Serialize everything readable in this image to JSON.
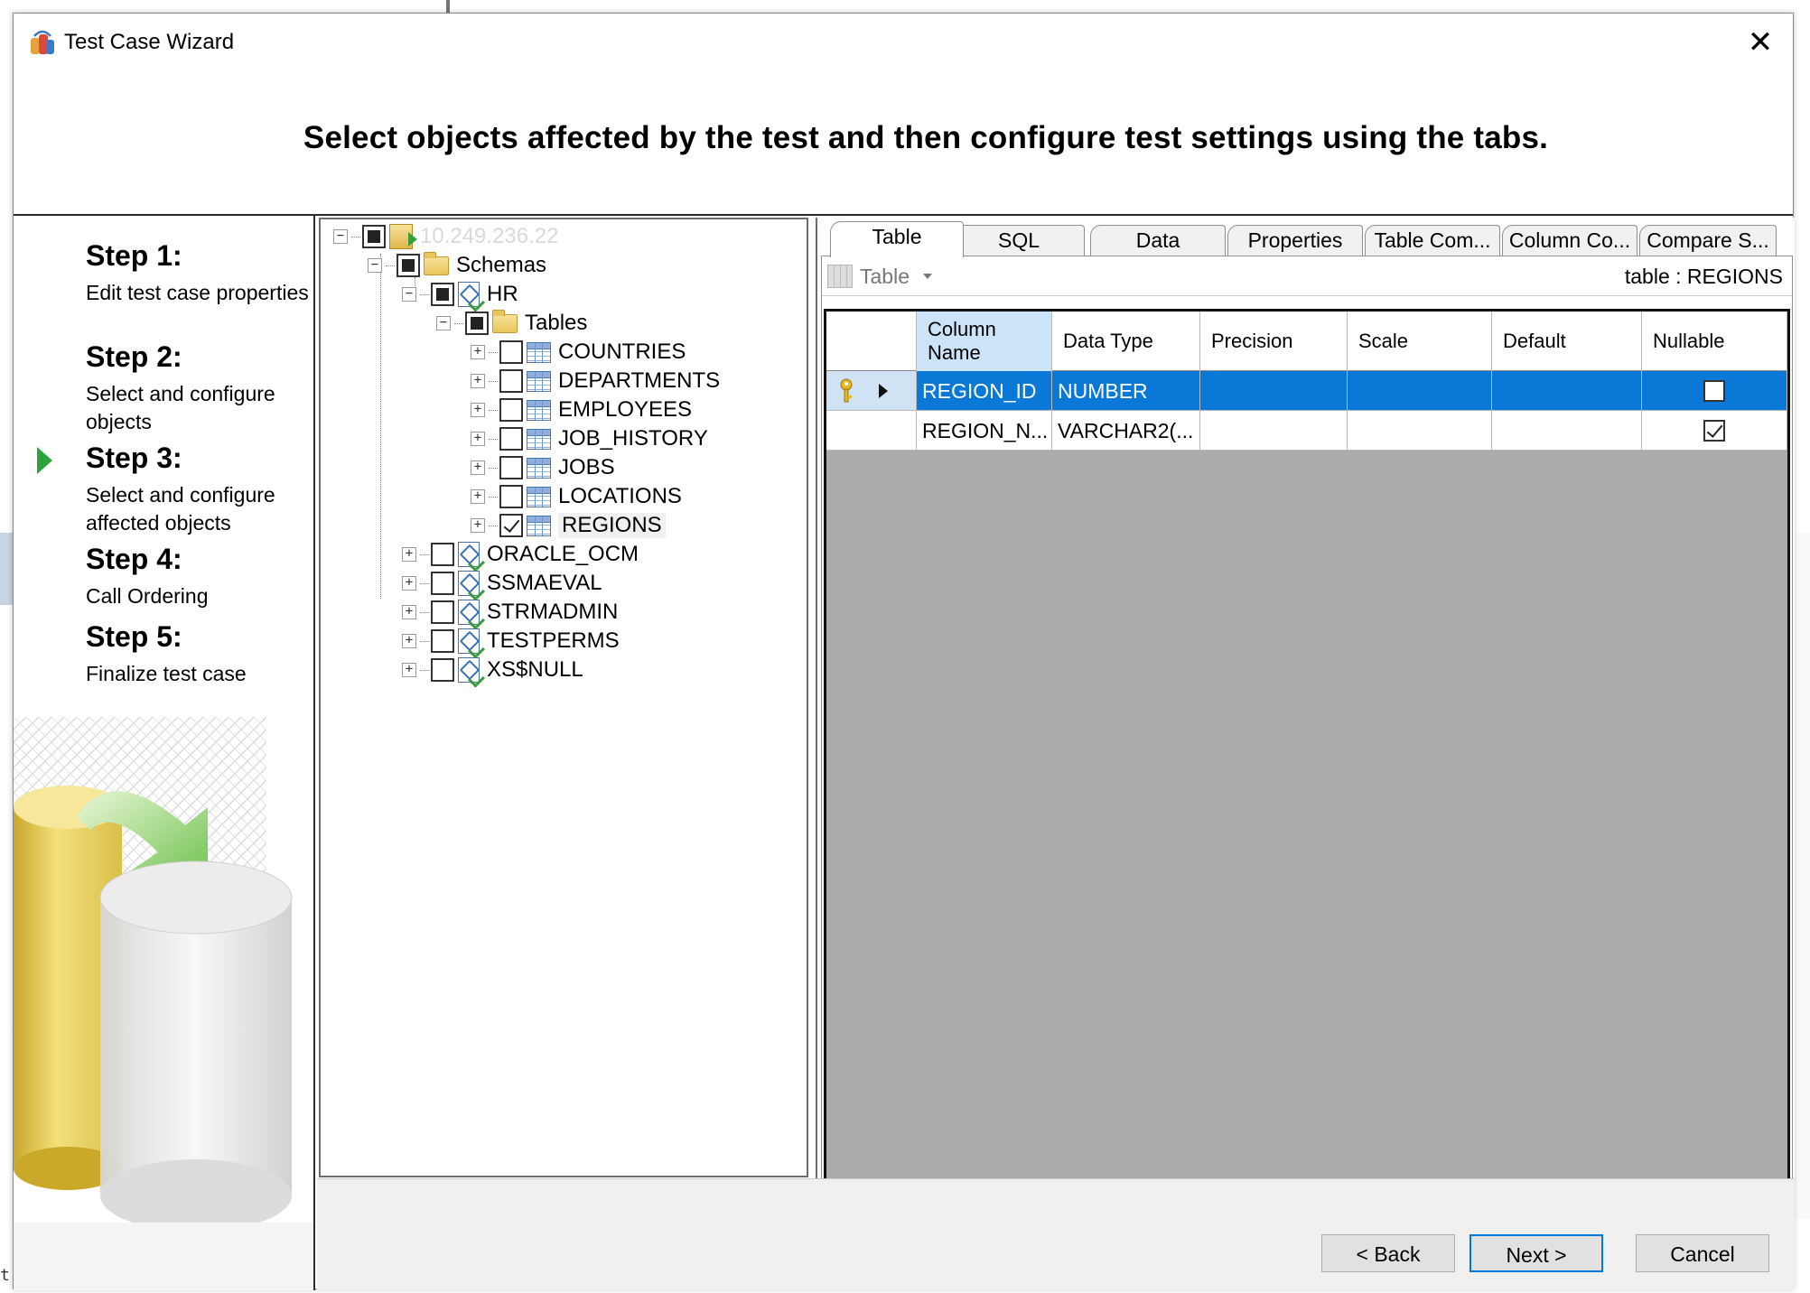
{
  "window": {
    "title": "Test Case Wizard",
    "close_glyph": "✕"
  },
  "header": {
    "text": "Select objects affected by the test and then configure test settings using the tabs."
  },
  "steps": [
    {
      "title": "Step 1:",
      "desc": "Edit test case properties"
    },
    {
      "title": "Step 2:",
      "desc": "Select and configure objects"
    },
    {
      "title": "Step 3:",
      "desc": "Select and configure affected objects",
      "current": true
    },
    {
      "title": "Step 4:",
      "desc": "Call Ordering"
    },
    {
      "title": "Step 5:",
      "desc": "Finalize test case"
    }
  ],
  "tree": {
    "server": "10.249.236.22",
    "schemas_label": "Schemas",
    "hr_label": "HR",
    "tables_label": "Tables",
    "tables": [
      "COUNTRIES",
      "DEPARTMENTS",
      "EMPLOYEES",
      "JOB_HISTORY",
      "JOBS",
      "LOCATIONS",
      "REGIONS"
    ],
    "checked_table": "REGIONS",
    "other_schemas": [
      "ORACLE_OCM",
      "SSMAEVAL",
      "STRMADMIN",
      "TESTPERMS",
      "XS$NULL"
    ]
  },
  "tabs": [
    "Table",
    "SQL",
    "Data",
    "Properties",
    "Table Com...",
    "Column Co...",
    "Compare S..."
  ],
  "active_tab": "Table",
  "toolbar": {
    "view_label": "Table",
    "object_label": "table : REGIONS"
  },
  "grid": {
    "columns": [
      "Column Name",
      "Data Type",
      "Precision",
      "Scale",
      "Default",
      "Nullable"
    ],
    "rows": [
      {
        "name": "REGION_ID",
        "type": "NUMBER",
        "precision": "",
        "scale": "",
        "default": "",
        "nullable": false,
        "primary_key": true,
        "selected": true
      },
      {
        "name": "REGION_N...",
        "type": "VARCHAR2(...",
        "precision": "",
        "scale": "",
        "default": "",
        "nullable": true,
        "primary_key": false,
        "selected": false
      }
    ]
  },
  "buttons": {
    "back": "< Back",
    "next": "Next >",
    "cancel": "Cancel"
  },
  "colors": {
    "selection": "#0a78d7",
    "step_arrow": "#2fa33b"
  },
  "background": {
    "left_edge_char": "t"
  }
}
